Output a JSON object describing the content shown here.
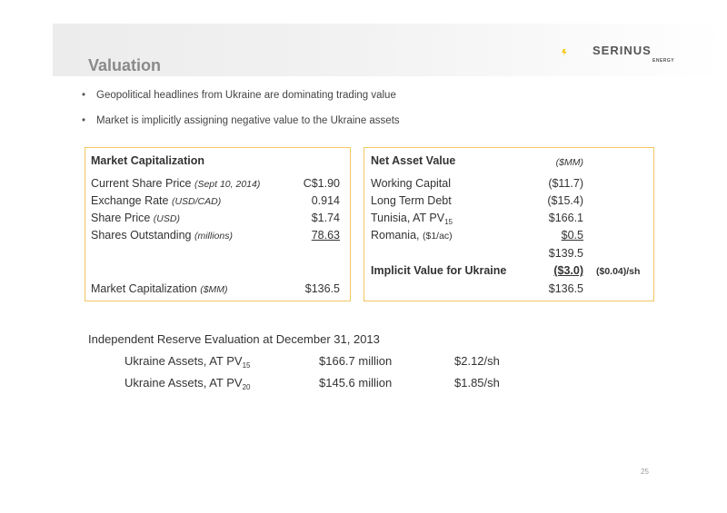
{
  "header": {
    "title": "Valuation",
    "logo_text": "SERINUS",
    "logo_sub": "ENERGY"
  },
  "bullets": [
    "Geopolitical headlines from Ukraine are dominating trading value",
    "Market is implicitly assigning negative value to the Ukraine assets"
  ],
  "market_cap": {
    "heading": "Market Capitalization",
    "rows": [
      {
        "label": "Current Share Price",
        "note": "(Sept 10, 2014)",
        "value": "C$1.90"
      },
      {
        "label": "Exchange Rate",
        "note": "(USD/CAD)",
        "value": "0.914"
      },
      {
        "label": "Share Price",
        "note": "(USD)",
        "value": "$1.74"
      },
      {
        "label": "Shares Outstanding",
        "note": "(millions)",
        "value": "78.63"
      }
    ],
    "total": {
      "label": "Market Capitalization",
      "note": "($MM)",
      "value": "$136.5"
    }
  },
  "nav": {
    "heading": "Net Asset Value",
    "unit": "($MM)",
    "rows": [
      {
        "label": "Working Capital",
        "value": "($11.7)"
      },
      {
        "label": "Long Term Debt",
        "value": "($15.4)"
      },
      {
        "label": "Tunisia, AT PV",
        "sub": "15",
        "value": "$166.1"
      },
      {
        "label": "Romania,",
        "note": "($1/ac)",
        "value": "$0.5"
      }
    ],
    "subtotal": "$139.5",
    "ukraine": {
      "label": "Implicit Value for Ukraine",
      "value": "($3.0)",
      "per_share": "($0.04)/sh"
    },
    "total": "$136.5"
  },
  "reserve": {
    "heading": "Independent Reserve Evaluation at December 31, 2013",
    "rows": [
      {
        "label": "Ukraine Assets, AT PV",
        "sub": "15",
        "amount": "$166.7 million",
        "per_share": "$2.12/sh"
      },
      {
        "label": "Ukraine Assets, AT PV",
        "sub": "20",
        "amount": "$145.6 million",
        "per_share": "$1.85/sh"
      }
    ]
  },
  "page_number": "25",
  "colors": {
    "box_border": "#f2c661",
    "logo_yellow": "#f5c400",
    "title_gray": "#8a8a8a"
  }
}
